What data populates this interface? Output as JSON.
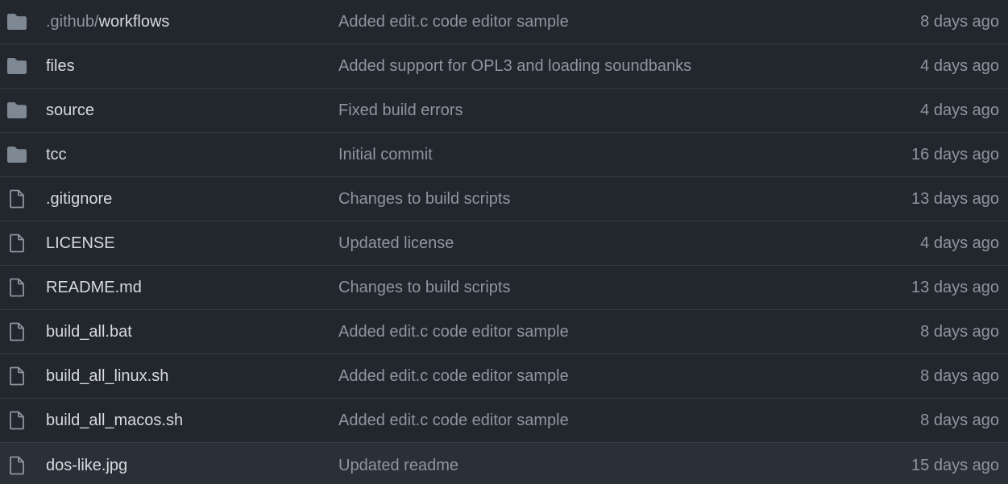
{
  "colors": {
    "background": "#22262d",
    "row_highlight": "#2b2f37",
    "divider": "#363b44",
    "folder_icon": "#7e8893",
    "file_icon": "#8e96a0",
    "name_text": "#d7dbe0",
    "muted_text": "#8e96a0"
  },
  "files": [
    {
      "type": "folder",
      "icon": "folder-icon",
      "name_prefix": ".github/",
      "name": "workflows",
      "commit": "Added edit.c code editor sample",
      "age": "8 days ago"
    },
    {
      "type": "folder",
      "icon": "folder-icon",
      "name_prefix": "",
      "name": "files",
      "commit": "Added support for OPL3 and loading soundbanks",
      "age": "4 days ago"
    },
    {
      "type": "folder",
      "icon": "folder-icon",
      "name_prefix": "",
      "name": "source",
      "commit": "Fixed build errors",
      "age": "4 days ago"
    },
    {
      "type": "folder",
      "icon": "folder-icon",
      "name_prefix": "",
      "name": "tcc",
      "commit": "Initial commit",
      "age": "16 days ago"
    },
    {
      "type": "file",
      "icon": "file-icon",
      "name_prefix": "",
      "name": ".gitignore",
      "commit": "Changes to build scripts",
      "age": "13 days ago"
    },
    {
      "type": "file",
      "icon": "file-icon",
      "name_prefix": "",
      "name": "LICENSE",
      "commit": "Updated license",
      "age": "4 days ago"
    },
    {
      "type": "file",
      "icon": "file-icon",
      "name_prefix": "",
      "name": "README.md",
      "commit": "Changes to build scripts",
      "age": "13 days ago"
    },
    {
      "type": "file",
      "icon": "file-icon",
      "name_prefix": "",
      "name": "build_all.bat",
      "commit": "Added edit.c code editor sample",
      "age": "8 days ago"
    },
    {
      "type": "file",
      "icon": "file-icon",
      "name_prefix": "",
      "name": "build_all_linux.sh",
      "commit": "Added edit.c code editor sample",
      "age": "8 days ago"
    },
    {
      "type": "file",
      "icon": "file-icon",
      "name_prefix": "",
      "name": "build_all_macos.sh",
      "commit": "Added edit.c code editor sample",
      "age": "8 days ago"
    },
    {
      "type": "file",
      "icon": "file-icon",
      "name_prefix": "",
      "name": "dos-like.jpg",
      "commit": "Updated readme",
      "age": "15 days ago",
      "highlighted": true
    }
  ]
}
